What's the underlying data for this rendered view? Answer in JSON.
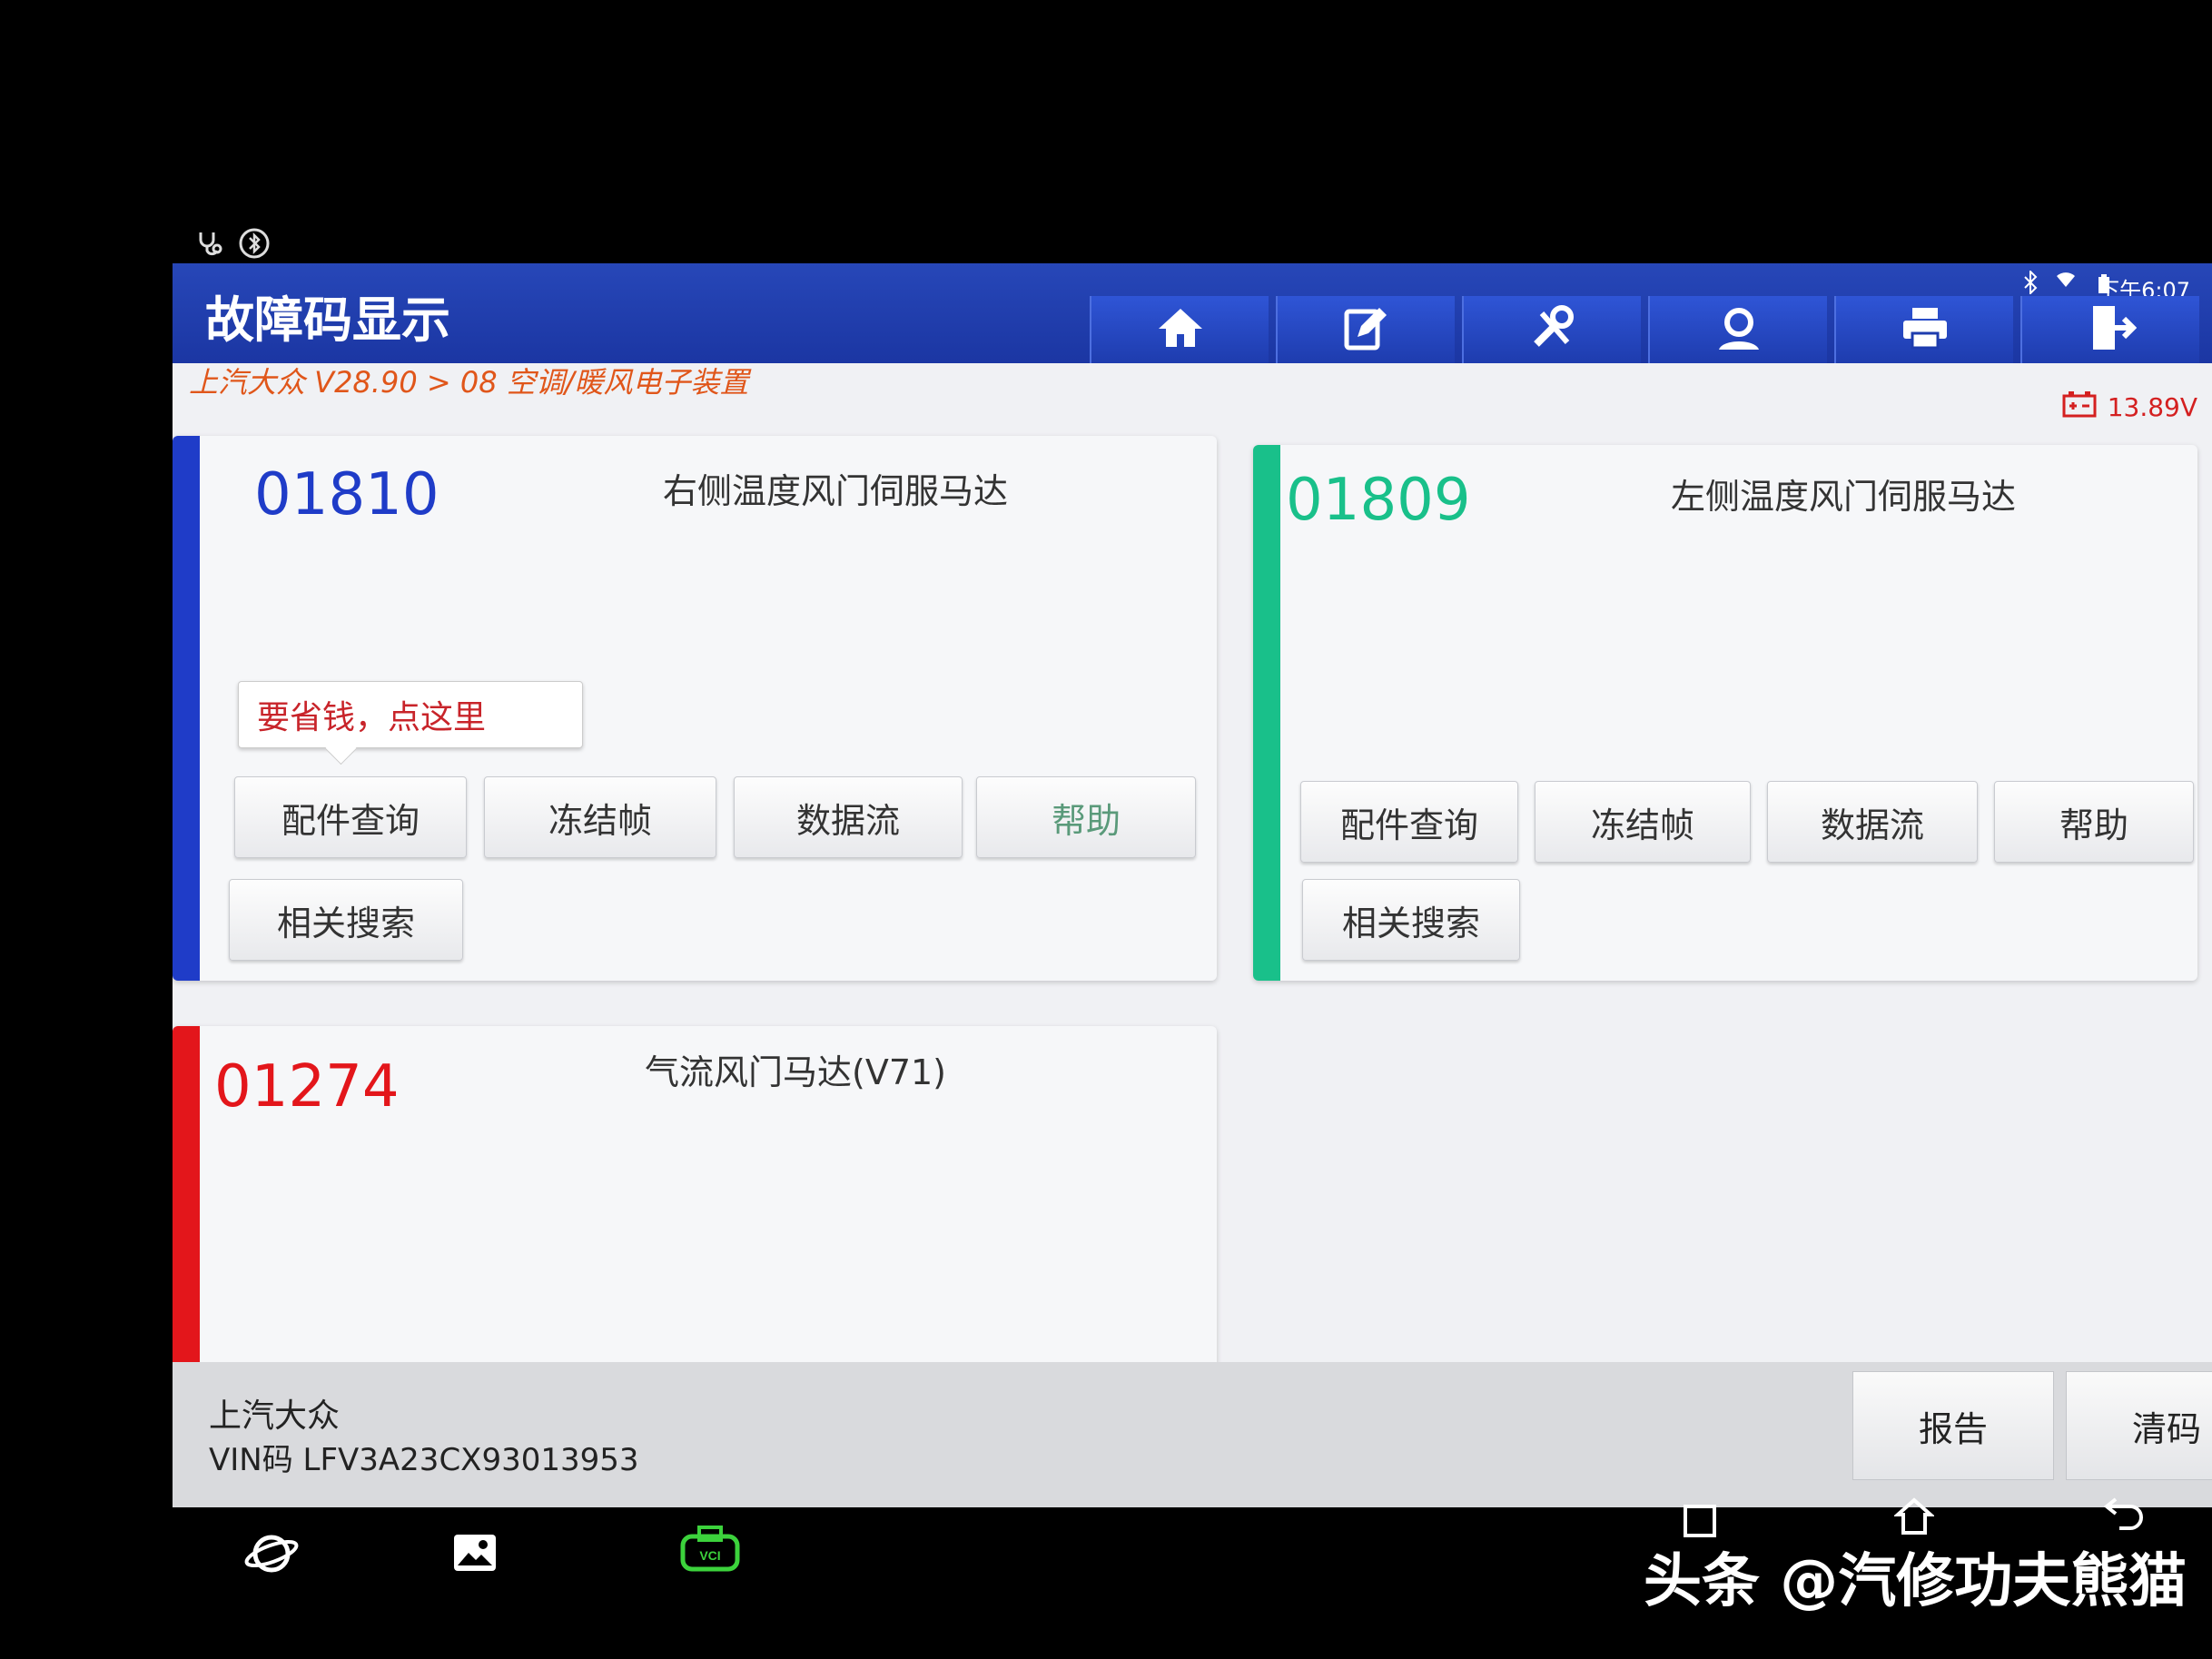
{
  "header": {
    "title": "故障码显示",
    "time": "下午6:07",
    "breadcrumb": "上汽大众 V28.90 > 08 空调/暖风电子装置",
    "voltage": "13.89V"
  },
  "nav": [
    {
      "name": "home-icon"
    },
    {
      "name": "edit-icon"
    },
    {
      "name": "tools-icon"
    },
    {
      "name": "user-icon"
    },
    {
      "name": "print-icon"
    },
    {
      "name": "exit-icon"
    }
  ],
  "cards": [
    {
      "code": "01810",
      "desc": "右侧温度风门伺服马达",
      "color": "#1f3cc8",
      "tip": "要省钱，点这里",
      "buttons": [
        "配件查询",
        "冻结帧",
        "数据流",
        "帮助",
        "相关搜索"
      ]
    },
    {
      "code": "01809",
      "desc": "左侧温度风门伺服马达",
      "color": "#19c08a",
      "buttons": [
        "配件查询",
        "冻结帧",
        "数据流",
        "帮助",
        "相关搜索"
      ]
    },
    {
      "code": "01274",
      "desc": "气流风门马达(V71)",
      "color": "#e3161b"
    }
  ],
  "footer": {
    "brand": "上汽大众",
    "vin": "VIN码 LFV3A23CX93013953",
    "report": "报告",
    "clear": "清码"
  },
  "watermark": "头条 @汽修功夫熊猫",
  "colors": {
    "topbar": "#1f3ba8",
    "accent_blue": "#1f3cc8",
    "accent_green": "#19c08a",
    "accent_red": "#e3161b",
    "vci_green": "#3cd23c"
  }
}
